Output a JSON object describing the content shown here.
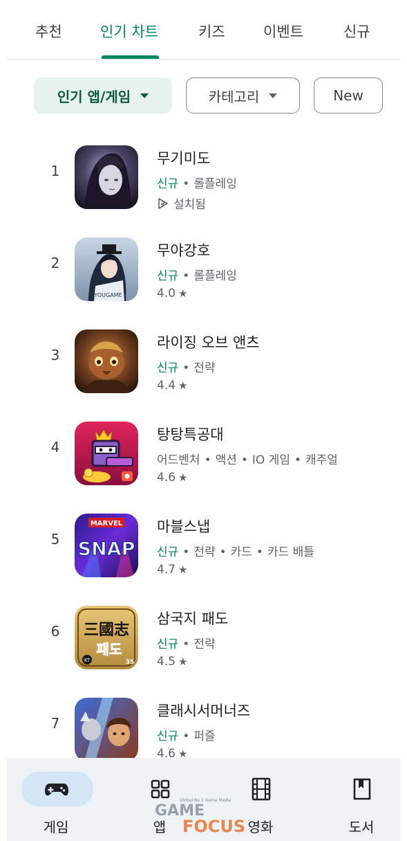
{
  "tabs": [
    {
      "label": "추천"
    },
    {
      "label": "인기 차트"
    },
    {
      "label": "키즈"
    },
    {
      "label": "이벤트"
    },
    {
      "label": "신규"
    }
  ],
  "active_tab": "인기 차트",
  "chips": {
    "popular": "인기 앱/게임",
    "category": "카테고리",
    "new": "New"
  },
  "apps": [
    {
      "rank": "1",
      "name": "무기미도",
      "badge": "신규",
      "tags": [
        "롤플레잉"
      ],
      "status": "설치됨",
      "icon": "game-icon-dark-haired-character"
    },
    {
      "rank": "2",
      "name": "무야강호",
      "badge": "신규",
      "tags": [
        "롤플레잉"
      ],
      "rating": "4.0",
      "icon": "game-icon-swordsman",
      "icon_text": "EYOUGAME"
    },
    {
      "rank": "3",
      "name": "라이징 오브 앤츠",
      "badge": "신규",
      "tags": [
        "전략"
      ],
      "rating": "4.4",
      "icon": "game-icon-ant-warrior"
    },
    {
      "rank": "4",
      "name": "탕탕특공대",
      "tags": [
        "어드벤처",
        "액션",
        "IO 게임",
        "캐주얼"
      ],
      "rating": "4.6",
      "icon": "game-icon-crowned-block-hero"
    },
    {
      "rank": "5",
      "name": "마블스냅",
      "badge": "신규",
      "tags": [
        "전략",
        "카드",
        "카드 배틀"
      ],
      "rating": "4.7",
      "icon": "game-icon-marvel-snap",
      "icon_text": {
        "top": "MARVEL",
        "main": "SNAP"
      }
    },
    {
      "rank": "6",
      "name": "삼국지 패도",
      "badge": "신규",
      "tags": [
        "전략"
      ],
      "rating": "4.5",
      "icon": "game-icon-three-kingdoms",
      "icon_text": {
        "main": "三國志",
        "sub": "패도",
        "corner": "KT",
        "badge": "35"
      }
    },
    {
      "rank": "7",
      "name": "클래시서머너즈",
      "badge": "신규",
      "tags": [
        "퍼즐"
      ],
      "rating": "4.6",
      "icon": "game-icon-clash-summoners"
    }
  ],
  "bottom_nav": [
    {
      "label": "게임",
      "icon": "gamepad-icon",
      "active": true
    },
    {
      "label": "앱",
      "icon": "apps-grid-icon"
    },
    {
      "label": "영화",
      "icon": "film-icon"
    },
    {
      "label": "도서",
      "icon": "book-icon"
    }
  ],
  "watermark": {
    "tagline": "Global No.1 Game Media",
    "word1": "GAME",
    "word2": "FOCUS"
  },
  "colors": {
    "accent": "#01875f",
    "chip_selected_bg": "#e6f3ee",
    "nav_bg": "#eef2f5",
    "nav_active_pill": "#d2e7f3",
    "watermark_orange": "#e97b3a"
  }
}
